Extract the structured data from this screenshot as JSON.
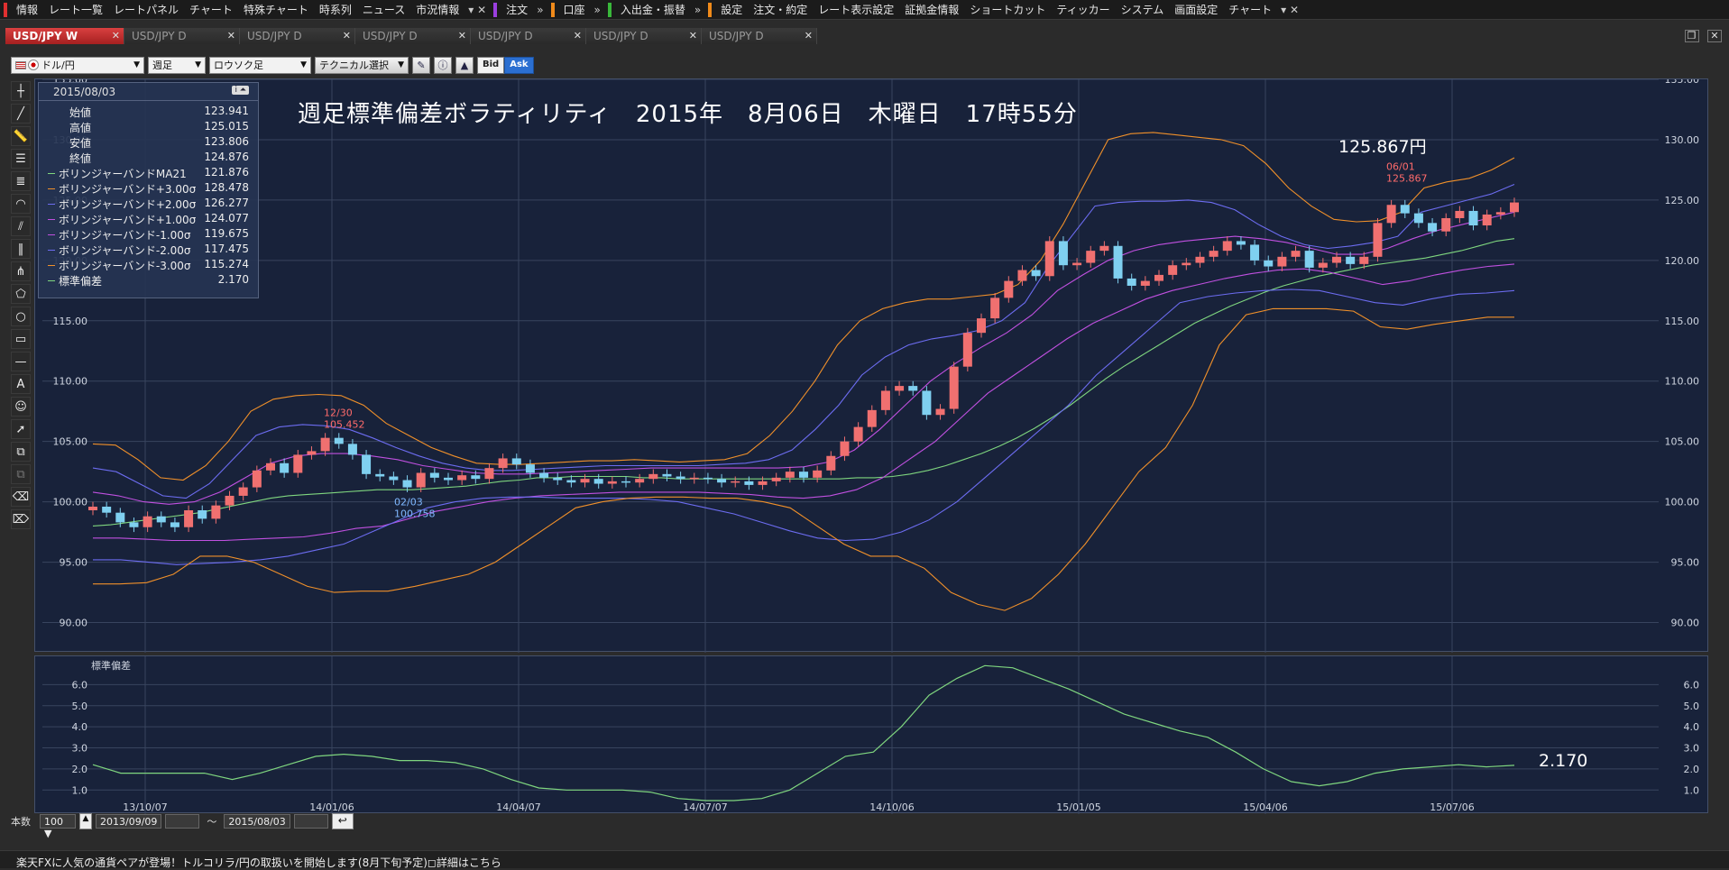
{
  "menu": {
    "groups": [
      {
        "accent": "#e03030",
        "items": [
          "情報",
          "レート一覧",
          "レートパネル",
          "チャート",
          "特殊チャート",
          "時系列",
          "ニュース",
          "市況情報"
        ]
      },
      {
        "accent": "#9b3fe0",
        "items": [
          "注文"
        ]
      },
      {
        "accent": "#f08a1a",
        "items": [
          "口座"
        ]
      },
      {
        "accent": "#39b83a",
        "items": [
          "入出金・振替"
        ]
      },
      {
        "accent": "#f08a1a",
        "items": [
          "設定",
          "注文・約定",
          "レート表示設定",
          "証拠金情報",
          "ショートカット",
          "ティッカー",
          "システム",
          "画面設定",
          "チャート"
        ]
      }
    ]
  },
  "tabs": [
    {
      "label": "USD/JPY W",
      "active": true
    },
    {
      "label": "USD/JPY D",
      "active": false
    },
    {
      "label": "USD/JPY D",
      "active": false
    },
    {
      "label": "USD/JPY D",
      "active": false
    },
    {
      "label": "USD/JPY D",
      "active": false
    },
    {
      "label": "USD/JPY D",
      "active": false
    },
    {
      "label": "USD/JPY D",
      "active": false
    }
  ],
  "toolbar": {
    "pair": "ドル/円",
    "period": "週足",
    "chart_type": "ロウソク足",
    "technical": "テクニカル選択",
    "bid": "Bid",
    "ask": "Ask"
  },
  "ohlc_panel": {
    "date": "2015/08/03",
    "rows": [
      {
        "label": "始値",
        "value": "123.941",
        "color": ""
      },
      {
        "label": "高値",
        "value": "125.015",
        "color": ""
      },
      {
        "label": "安値",
        "value": "123.806",
        "color": ""
      },
      {
        "label": "終値",
        "value": "124.876",
        "color": ""
      },
      {
        "label": "ボリンジャーバンドMA21",
        "value": "121.876",
        "color": "#7fd67f"
      },
      {
        "label": "ボリンジャーバンド+3.00σ",
        "value": "128.478",
        "color": "#f0902a"
      },
      {
        "label": "ボリンジャーバンド+2.00σ",
        "value": "126.277",
        "color": "#6c6cf0"
      },
      {
        "label": "ボリンジャーバンド+1.00σ",
        "value": "124.077",
        "color": "#c050e0"
      },
      {
        "label": "ボリンジャーバンド-1.00σ",
        "value": "119.675",
        "color": "#c050e0"
      },
      {
        "label": "ボリンジャーバンド-2.00σ",
        "value": "117.475",
        "color": "#6c6cf0"
      },
      {
        "label": "ボリンジャーバンド-3.00σ",
        "value": "115.274",
        "color": "#f0902a"
      },
      {
        "label": "標準偏差",
        "value": "2.170",
        "color": "#7fd67f"
      }
    ]
  },
  "overlay": {
    "title": "週足標準偏差ボラティリティ　2015年　8月06日　木曜日　17時55分",
    "price": "125.867円",
    "sub_value": "2.170"
  },
  "annotations": [
    {
      "date": "12/30",
      "value": "105.452",
      "color": "#ff6b6b"
    },
    {
      "date": "02/03",
      "value": "100.758",
      "color": "#7fb8ff"
    },
    {
      "date": "06/01",
      "value": "125.867",
      "color": "#ff6b6b"
    }
  ],
  "sub_pane": {
    "label": "標準偏差"
  },
  "bottom": {
    "count_label": "本数",
    "count_value": "100",
    "start_date": "2013/09/09",
    "tilde": "〜",
    "end_date": "2015/08/03"
  },
  "news": "楽天FXに人気の通貨ペアが登場！トルコリラ/円の取扱いを開始します(8月下旬予定)◻詳細はこちら",
  "chart_data": [
    {
      "type": "line",
      "name": "price",
      "yticks": [
        "135.00",
        "130.00",
        "125.00",
        "120.00",
        "115.00",
        "110.00",
        "105.00",
        "100.00",
        "95.00",
        "90.00"
      ],
      "ylim": [
        87.5,
        135
      ],
      "xticks": [
        "13/10/07",
        "14/01/06",
        "14/04/07",
        "14/07/07",
        "14/10/06",
        "15/01/05",
        "15/04/06",
        "15/07/06"
      ],
      "ohlc_close": [
        99.6,
        99.1,
        98.3,
        97.9,
        98.8,
        98.3,
        97.9,
        99.3,
        98.6,
        99.7,
        100.5,
        101.2,
        102.6,
        103.2,
        102.4,
        103.9,
        104.2,
        105.3,
        104.8,
        103.9,
        102.3,
        102.1,
        101.8,
        101.2,
        102.4,
        102.0,
        101.8,
        102.2,
        101.9,
        102.8,
        103.6,
        103.1,
        102.4,
        102.0,
        101.8,
        101.6,
        101.9,
        101.5,
        101.7,
        101.6,
        101.9,
        102.3,
        102.1,
        101.9,
        102.0,
        101.9,
        101.6,
        101.7,
        101.4,
        101.7,
        102.0,
        102.5,
        102.0,
        102.6,
        103.8,
        105.0,
        106.2,
        107.6,
        109.2,
        109.6,
        109.2,
        107.2,
        107.7,
        111.2,
        114.0,
        115.2,
        116.9,
        118.3,
        119.2,
        118.7,
        121.6,
        119.6,
        119.8,
        120.8,
        121.2,
        118.5,
        117.9,
        118.3,
        118.8,
        119.6,
        119.8,
        120.3,
        120.8,
        121.6,
        121.3,
        120.0,
        119.5,
        120.3,
        120.8,
        119.4,
        119.8,
        120.3,
        119.7,
        120.3,
        123.1,
        124.6,
        123.9,
        123.1,
        122.4,
        123.5,
        124.1,
        122.9,
        123.8,
        124.0,
        124.8
      ],
      "series": [
        {
          "name": "ボリンジャーバンドMA21",
          "color": "#7fd67f",
          "values": [
            98.0,
            98.1,
            98.3,
            98.5,
            98.7,
            98.9,
            99.1,
            99.4,
            99.7,
            100.0,
            100.3,
            100.5,
            100.6,
            100.7,
            100.8,
            100.9,
            101.0,
            101.0,
            101.0,
            101.1,
            101.2,
            101.3,
            101.5,
            101.7,
            101.8,
            102.0,
            102.0,
            102.1,
            102.1,
            102.1,
            102.1,
            102.0,
            102.0,
            101.9,
            101.9,
            101.9,
            101.9,
            101.9,
            101.9,
            101.9,
            101.9,
            101.9,
            101.9,
            102.0,
            102.0,
            102.1,
            102.3,
            102.6,
            103.0,
            103.5,
            104.0,
            104.6,
            105.3,
            106.1,
            107.0,
            108.0,
            109.1,
            110.2,
            111.2,
            112.1,
            113.0,
            113.9,
            114.8,
            115.5,
            116.2,
            116.8,
            117.4,
            117.9,
            118.3,
            118.7,
            119.0,
            119.3,
            119.6,
            119.8,
            120.0,
            120.2,
            120.5,
            120.8,
            121.2,
            121.6,
            121.8
          ]
        },
        {
          "name": "ボリンジャーバンド+3.00σ",
          "color": "#f0902a",
          "values": [
            104.8,
            104.7,
            103.5,
            102.0,
            101.8,
            103.0,
            105.0,
            107.5,
            108.5,
            108.8,
            108.9,
            108.8,
            108.0,
            106.5,
            105.5,
            104.5,
            103.8,
            103.2,
            103.1,
            103.1,
            103.2,
            103.3,
            103.4,
            103.4,
            103.5,
            103.4,
            103.3,
            103.4,
            103.5,
            104.0,
            105.5,
            107.5,
            110.0,
            113.0,
            115.0,
            116.0,
            116.5,
            116.8,
            116.8,
            117.0,
            117.2,
            118.0,
            120.0,
            123.0,
            126.5,
            130.0,
            130.5,
            130.6,
            130.4,
            130.2,
            130.0,
            129.5,
            128.0,
            126.0,
            124.5,
            123.4,
            123.2,
            123.3,
            124.0,
            126.0,
            126.5,
            126.8,
            127.5,
            128.5
          ]
        },
        {
          "name": "ボリンジャーバンド+2.00σ",
          "color": "#6c6cf0",
          "values": [
            102.8,
            102.5,
            101.5,
            100.5,
            100.3,
            101.5,
            103.5,
            105.5,
            106.2,
            106.4,
            106.3,
            106.0,
            105.3,
            104.5,
            103.8,
            103.2,
            102.8,
            102.6,
            102.6,
            102.7,
            102.8,
            102.9,
            103.0,
            103.0,
            103.0,
            103.0,
            103.0,
            103.1,
            103.2,
            103.5,
            104.3,
            106.0,
            108.0,
            110.5,
            112.0,
            113.0,
            113.5,
            113.8,
            114.2,
            115.0,
            116.5,
            119.5,
            122.0,
            124.5,
            124.8,
            124.9,
            124.9,
            125.0,
            124.8,
            124.2,
            123.0,
            122.0,
            121.3,
            121.0,
            121.2,
            121.5,
            122.0,
            124.0,
            124.5,
            125.0,
            125.5,
            126.3
          ]
        },
        {
          "name": "ボリンジャーバンド+1.00σ",
          "color": "#c050e0",
          "values": [
            100.8,
            100.5,
            100.0,
            99.8,
            100.0,
            100.8,
            102.0,
            103.2,
            103.8,
            104.0,
            104.0,
            103.8,
            103.5,
            103.0,
            102.7,
            102.4,
            102.3,
            102.3,
            102.4,
            102.5,
            102.6,
            102.7,
            102.8,
            102.8,
            102.8,
            102.8,
            102.8,
            102.8,
            102.9,
            103.3,
            104.3,
            106.0,
            108.0,
            110.0,
            111.5,
            112.8,
            114.0,
            115.5,
            117.5,
            118.8,
            120.0,
            120.8,
            121.3,
            121.6,
            121.8,
            122.0,
            121.8,
            121.5,
            121.0,
            120.5,
            120.5,
            121.0,
            121.8,
            122.5,
            123.0,
            123.5,
            124.0
          ]
        },
        {
          "name": "ボリンジャーバンド-1.00σ",
          "color": "#c050e0",
          "values": [
            97.0,
            97.0,
            96.9,
            96.8,
            96.8,
            96.8,
            96.9,
            97.0,
            97.1,
            97.4,
            97.8,
            98.0,
            98.6,
            99.2,
            99.6,
            100.0,
            100.3,
            100.5,
            100.6,
            100.7,
            100.8,
            100.8,
            100.8,
            100.8,
            100.7,
            100.6,
            100.4,
            100.3,
            100.5,
            101.0,
            102.0,
            103.5,
            105.0,
            107.0,
            109.0,
            110.5,
            112.0,
            113.5,
            114.8,
            115.8,
            116.8,
            117.5,
            118.0,
            118.5,
            118.9,
            119.2,
            119.3,
            119.0,
            118.5,
            118.0,
            118.3,
            118.8,
            119.2,
            119.5,
            119.7
          ]
        },
        {
          "name": "ボリンジャーバンド-2.00σ",
          "color": "#6c6cf0",
          "values": [
            95.2,
            95.2,
            95.0,
            94.8,
            94.9,
            95.0,
            95.2,
            95.5,
            96.0,
            96.5,
            97.5,
            98.5,
            99.5,
            100.0,
            100.3,
            100.4,
            100.4,
            100.3,
            100.3,
            100.3,
            100.2,
            100.0,
            99.5,
            99.0,
            98.3,
            97.6,
            97.0,
            96.8,
            96.9,
            97.5,
            98.5,
            100.0,
            102.0,
            104.0,
            106.0,
            108.0,
            110.5,
            112.5,
            114.5,
            116.5,
            117.0,
            117.3,
            117.5,
            117.6,
            117.5,
            117.0,
            116.5,
            116.3,
            116.8,
            117.2,
            117.3,
            117.5
          ]
        },
        {
          "name": "ボリンジャーバンド-3.00σ",
          "color": "#f0902a",
          "values": [
            93.2,
            93.2,
            93.3,
            94.0,
            95.5,
            95.5,
            95.0,
            94.0,
            93.0,
            92.5,
            92.6,
            92.6,
            93.0,
            93.5,
            94.0,
            95.0,
            96.5,
            98.0,
            99.5,
            100.0,
            100.3,
            100.4,
            100.4,
            100.3,
            100.3,
            100.0,
            99.5,
            98.0,
            96.5,
            95.5,
            95.5,
            94.5,
            92.5,
            91.5,
            91.0,
            92.0,
            94.0,
            96.5,
            99.5,
            102.5,
            104.5,
            108.0,
            113.0,
            115.5,
            116.0,
            116.0,
            116.0,
            115.8,
            114.5,
            114.3,
            114.7,
            115.0,
            115.3,
            115.3
          ]
        }
      ]
    },
    {
      "type": "line",
      "name": "標準偏差",
      "yticks": [
        "6.0",
        "5.0",
        "4.0",
        "3.0",
        "2.0",
        "1.0"
      ],
      "ylim": [
        0.5,
        7
      ],
      "values": [
        2.2,
        1.8,
        1.8,
        1.8,
        1.8,
        1.5,
        1.8,
        2.2,
        2.6,
        2.7,
        2.6,
        2.4,
        2.4,
        2.3,
        2.0,
        1.5,
        1.1,
        1.0,
        1.0,
        1.0,
        0.9,
        0.6,
        0.5,
        0.5,
        0.6,
        1.0,
        1.8,
        2.6,
        2.8,
        4.0,
        5.5,
        6.3,
        6.9,
        6.8,
        6.3,
        5.8,
        5.2,
        4.6,
        4.2,
        3.8,
        3.5,
        2.8,
        2.0,
        1.4,
        1.2,
        1.4,
        1.8,
        2.0,
        2.1,
        2.2,
        2.1,
        2.17
      ]
    }
  ]
}
